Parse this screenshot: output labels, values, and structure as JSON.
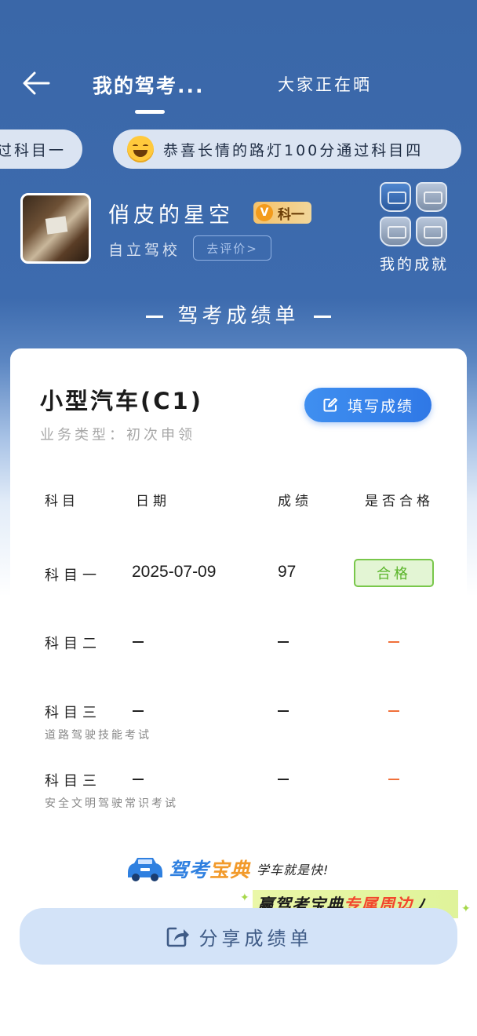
{
  "header": {
    "tab_mine": "我的驾考...",
    "tab_others": "大家正在晒"
  },
  "ticker": {
    "item1": "过科目一",
    "item2": "恭喜长情的路灯100分通过科目四"
  },
  "profile": {
    "username": "俏皮的星空",
    "level_icon": "V",
    "level_label": "科一",
    "school": "自立驾校",
    "rate_button": "去评价>",
    "achievements_label": "我的成就"
  },
  "section_title": "驾考成绩单",
  "card": {
    "car_type": "小型汽车(C1)",
    "business_type": "业务类型：初次申领",
    "fill_button": "填写成绩",
    "columns": [
      "科目",
      "日期",
      "成绩",
      "是否合格"
    ],
    "rows": [
      {
        "subject": "科目一",
        "sub": "",
        "date": "2025-07-09",
        "score": "97",
        "pass": "合格"
      },
      {
        "subject": "科目二",
        "sub": "",
        "date": "–",
        "score": "–",
        "pass": "–"
      },
      {
        "subject": "科目三",
        "sub": "道路驾驶技能考试",
        "date": "–",
        "score": "–",
        "pass": "–"
      },
      {
        "subject": "科目三",
        "sub": "安全文明驾驶常识考试",
        "date": "–",
        "score": "–",
        "pass": "–"
      }
    ],
    "logo_name_1": "驾考",
    "logo_name_2": "宝典",
    "logo_slogan": "学车就是快!"
  },
  "promo": {
    "part1": "赢驾考宝典",
    "part2": "专属周边"
  },
  "share_button": "分享成绩单",
  "colors": {
    "header_blue": "#3a67a8",
    "accent_blue": "#2f78e6",
    "pass_green": "#5bb52b",
    "dash_orange": "#f0703a"
  }
}
